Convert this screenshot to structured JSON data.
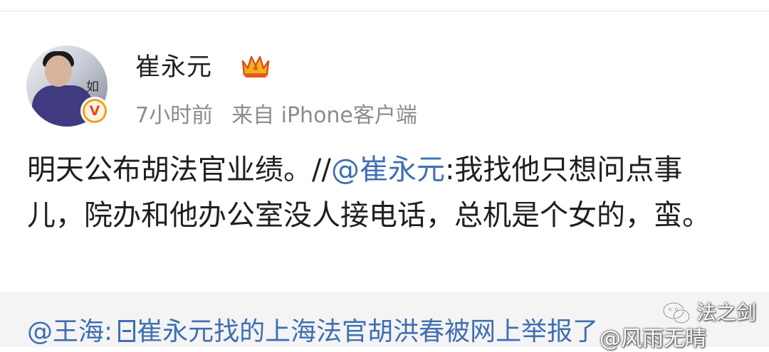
{
  "user": {
    "name": "崔永元",
    "avatar_glyph": "如",
    "verified_badge": "V",
    "crown_icon": "crown-icon"
  },
  "meta": {
    "time": "7小时前",
    "source": "来自 iPhone客户端"
  },
  "post": {
    "text_before": "明天公布胡法官业绩。//",
    "mention": "@崔永元",
    "text_after": ":我找他只想问点事儿，院办和他办公室没人接电话，总机是个女的，蛮。"
  },
  "repost": {
    "author": "@王海",
    "separator": ":",
    "text": "崔永元找的上海法官胡洪春被网上举报了"
  },
  "watermark": {
    "channel": "法之剑",
    "source": "@风雨无晴"
  },
  "colors": {
    "link": "#3f6fb2",
    "meta_gray": "#8c8c8c",
    "badge_orange": "#f2a21b",
    "crown_gold": "#f0b11c"
  }
}
